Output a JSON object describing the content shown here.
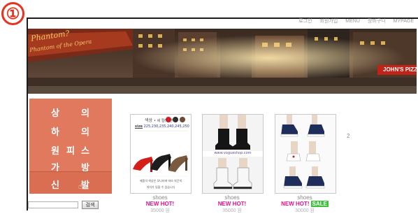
{
  "step_badge": "①",
  "top_nav": [
    "로그인",
    "회원가입",
    "MENU",
    "장바구니",
    "MYPAGE"
  ],
  "banner": {
    "sign_line1": "Phantom?",
    "sign_line2": "Phantom of the Opera",
    "store_sign": "JOHN'S PIZZ"
  },
  "categories": [
    {
      "char1": "상",
      "char2": "의"
    },
    {
      "char1": "하",
      "char2": "의"
    },
    {
      "char1": "원",
      "char2": "피",
      "char3": "스"
    },
    {
      "char1": "가",
      "char2": "방"
    },
    {
      "char1": "신",
      "char2": "발"
    }
  ],
  "search": {
    "button_label": "검색",
    "value": ""
  },
  "products": [
    {
      "name": "shoes",
      "tag": "NEW HOT!",
      "price": "35000 원",
      "color_label": "색상",
      "color_note": "• 세 컬러 선택",
      "size_label": "size",
      "sizes": "225,230,235,240,245,250",
      "note_line1": "제품의 색상은 모니터에 따라 약간씩",
      "note_line2": "차이가 있을 수 있습니다"
    },
    {
      "name": "shoes",
      "tag": "NEW HOT!",
      "price": "35000 원",
      "watermark": "www.vogueshop.com"
    },
    {
      "name": "shoes",
      "tag": "NEW HOT!",
      "sale": "SALE",
      "price": "30000 원"
    }
  ],
  "pagination": {
    "page": "2"
  },
  "colors": {
    "accent": "#e8321e",
    "menu_bg": "#e0795d",
    "tag_pink": "#e0158a",
    "sale_green": "#39c43a"
  }
}
